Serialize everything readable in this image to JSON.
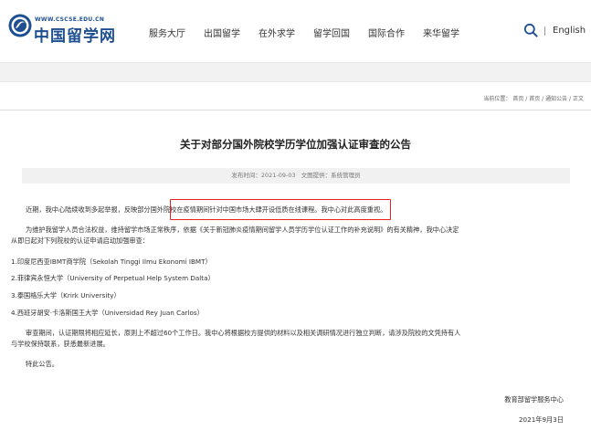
{
  "header": {
    "logo_url": "WWW.CSCSE.EDU.CN",
    "logo_title": "中国留学网",
    "nav": [
      "服务大厅",
      "出国留学",
      "在外求学",
      "留学回国",
      "国际合作",
      "来华留学"
    ],
    "lang": "English",
    "lang_separator": "|"
  },
  "breadcrumb": {
    "prefix": "当前位置：",
    "items": [
      "首页",
      "首页",
      "通知公告",
      "正文"
    ],
    "separator": " / "
  },
  "article": {
    "title": "关于对部分国外院校学历学位加强认证审查的公告",
    "publish_label": "发布时间：2021-09-03",
    "provider_label": "文图提供：系统管理员",
    "p1_a": "近期，我中心陆续收到多起举报，反映",
    "p1_b": "部分国外院校在疫情期间针对中国市场大肆开设低质在线课程",
    "p1_c": "。我中心对此高度重视。",
    "p2_line1": "为维护我留学人员合法权益，维持留学市场正常秩序，依据《关于新冠肺炎疫情期间留学人员学历学位认证工作的补充说明》的有关精神，我中心决定",
    "p2_line2": "从即日起对下列院校的认证申请启动加强审查：",
    "schools": [
      "1.印度尼西亚IBMT商学院（Sekolah Tinggi Ilmu Ekonomi IBMT）",
      "2.菲律宾永恒大学（University of Perpetual Help System Dalta）",
      "3.泰国格乐大学（Krirk University）",
      "4.西班牙胡安·卡洛斯国王大学（Universidad Rey Juan Carlos）"
    ],
    "p3_line1": "审查期间，认证期限将相应延长，原则上不超过60个工作日。我中心将根据校方提供的材料以及相关调研情况进行独立判断，请涉及院校的文凭持有人",
    "p3_line2": "与学校保持联系，获悉最新进展。",
    "closing": "特此公告。",
    "signature": "教育部留学服务中心",
    "date": "2021年9月3日"
  },
  "colors": {
    "brand_blue": "#1d4f91",
    "highlight_red": "#e8231f"
  },
  "icons": {
    "search": "search-icon",
    "logo": "cscse-emblem-icon"
  }
}
